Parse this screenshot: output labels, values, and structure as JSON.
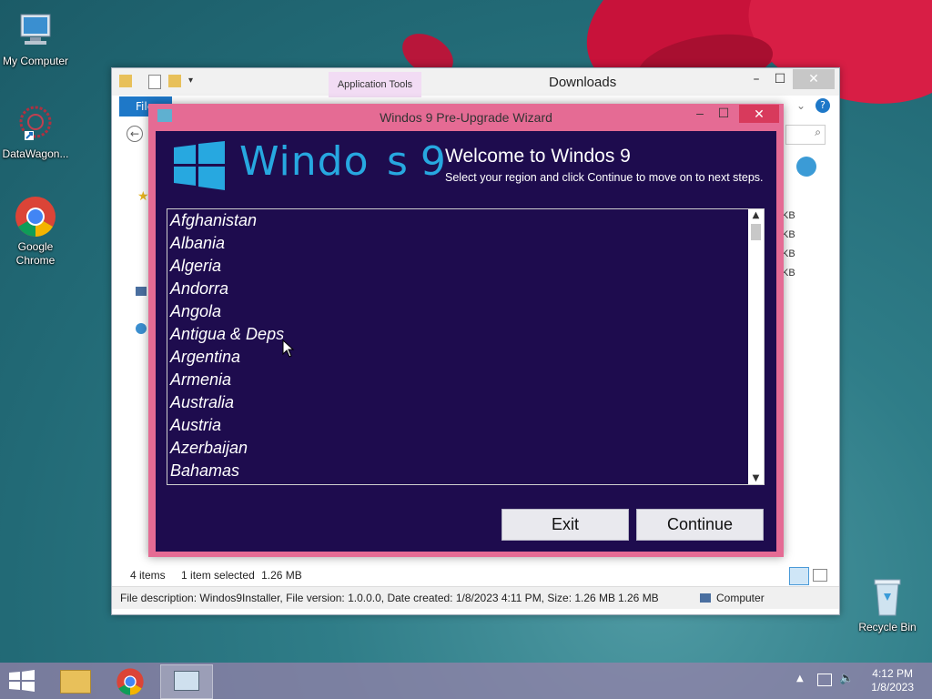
{
  "desktop": {
    "icons": [
      {
        "label": "My Computer"
      },
      {
        "label": "DataWagon..."
      },
      {
        "label": "Google Chrome"
      },
      {
        "label": "Recycle Bin"
      }
    ]
  },
  "explorer": {
    "title": "Downloads",
    "ribbon_context_tab": "Application Tools",
    "file_tab": "File",
    "status_items": "4 items",
    "status_selected": "1 item selected",
    "status_size": "1.26 MB",
    "file_sizes": [
      "KB",
      "KB",
      "KB",
      "KB"
    ],
    "details_bar": {
      "description": "File description: Windos9Installer, File version: 1.0.0.0, Date created: 1/8/2023 4:11 PM, Size: 1.26 MB",
      "size": "1.26 MB",
      "location": "Computer"
    }
  },
  "wizard": {
    "title": "Windos 9 Pre-Upgrade Wizard",
    "logo_text": "Windo",
    "logo_suffix": "s 9",
    "heading": "Welcome to Windos 9",
    "subheading": "Select your region and click Continue to move on to next steps.",
    "countries": [
      "Afghanistan",
      "Albania",
      "Algeria",
      "Andorra",
      "Angola",
      "Antigua & Deps",
      "Argentina",
      "Armenia",
      "Australia",
      "Austria",
      "Azerbaijan",
      "Bahamas"
    ],
    "exit_label": "Exit",
    "continue_label": "Continue"
  },
  "taskbar": {
    "time": "4:12 PM",
    "date": "1/8/2023"
  },
  "colors": {
    "wizard_frame": "#e56b94",
    "wizard_bg": "#1e0c4e",
    "logo_blue": "#27a8e0"
  }
}
